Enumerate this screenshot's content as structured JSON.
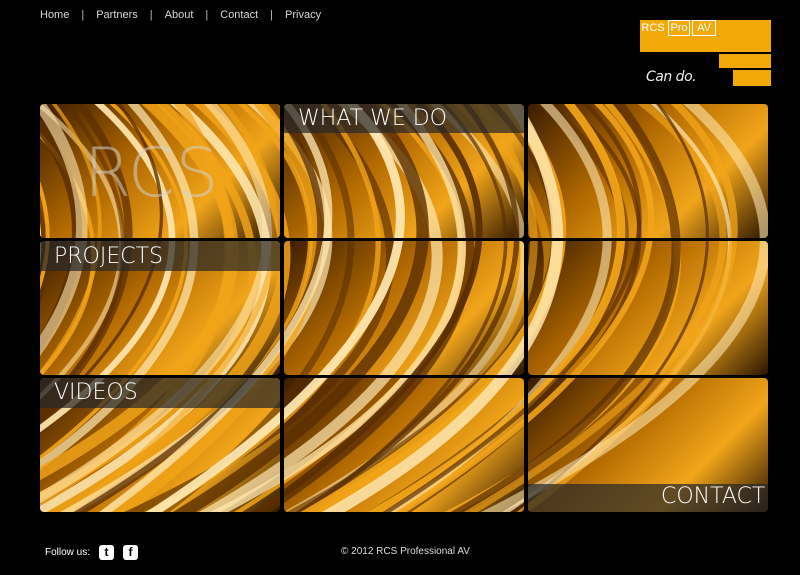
{
  "nav": {
    "items": [
      {
        "label": "Home"
      },
      {
        "label": "Partners"
      },
      {
        "label": "About"
      },
      {
        "label": "Contact"
      },
      {
        "label": "Privacy"
      }
    ],
    "separator": "|"
  },
  "logo": {
    "words": [
      "RCS",
      "Pro",
      "AV"
    ],
    "tagline": "Can do.",
    "color": "#f4a90a"
  },
  "tiles": {
    "rcs_watermark": "RCS",
    "what_we_do": "WHAT WE DO",
    "projects": "PROJECTS",
    "videos": "VIDEOS",
    "contact": "CONTACT"
  },
  "footer": {
    "follow_label": "Follow us:",
    "social": [
      {
        "icon": "twitter-icon",
        "glyph": "t"
      },
      {
        "icon": "facebook-icon",
        "glyph": "f"
      }
    ],
    "copyright": "© 2012 RCS Professional AV"
  }
}
